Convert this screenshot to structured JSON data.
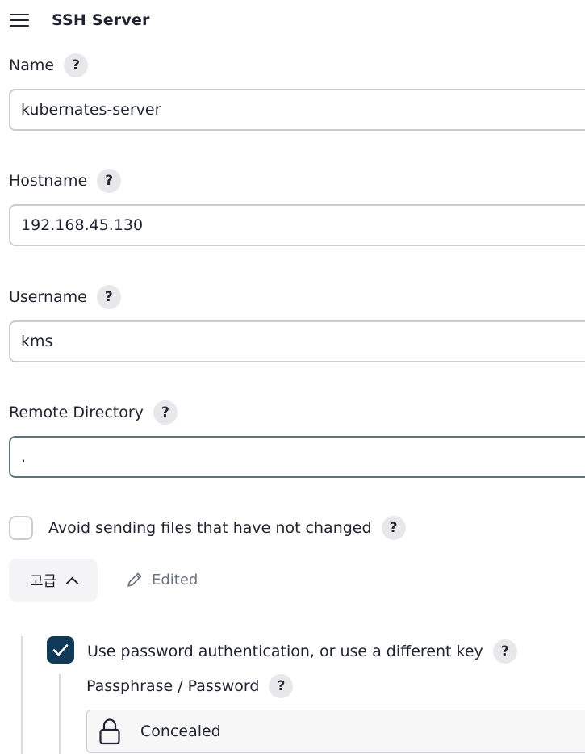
{
  "header": {
    "title": "SSH Server",
    "menu_icon": "hamburger-menu-icon"
  },
  "fields": {
    "name": {
      "label": "Name",
      "value": "kubernates-server",
      "help": "?"
    },
    "hostname": {
      "label": "Hostname",
      "value": "192.168.45.130",
      "help": "?"
    },
    "username": {
      "label": "Username",
      "value": "kms",
      "help": "?"
    },
    "remote_directory": {
      "label": "Remote Directory",
      "value": ".",
      "help": "?"
    }
  },
  "avoid_sending": {
    "label": "Avoid sending files that have not changed",
    "checked": false,
    "help": "?"
  },
  "advanced": {
    "label": "고급",
    "edited_label": "Edited",
    "expanded": true
  },
  "password_auth": {
    "label": "Use password authentication, or use a different key",
    "checked": true,
    "help": "?"
  },
  "passphrase": {
    "label": "Passphrase / Password",
    "help": "?",
    "value": "Concealed"
  },
  "colors": {
    "checkbox_checked": "#113a58",
    "border": "#c9ccd1",
    "focused_border": "#5f7478"
  }
}
